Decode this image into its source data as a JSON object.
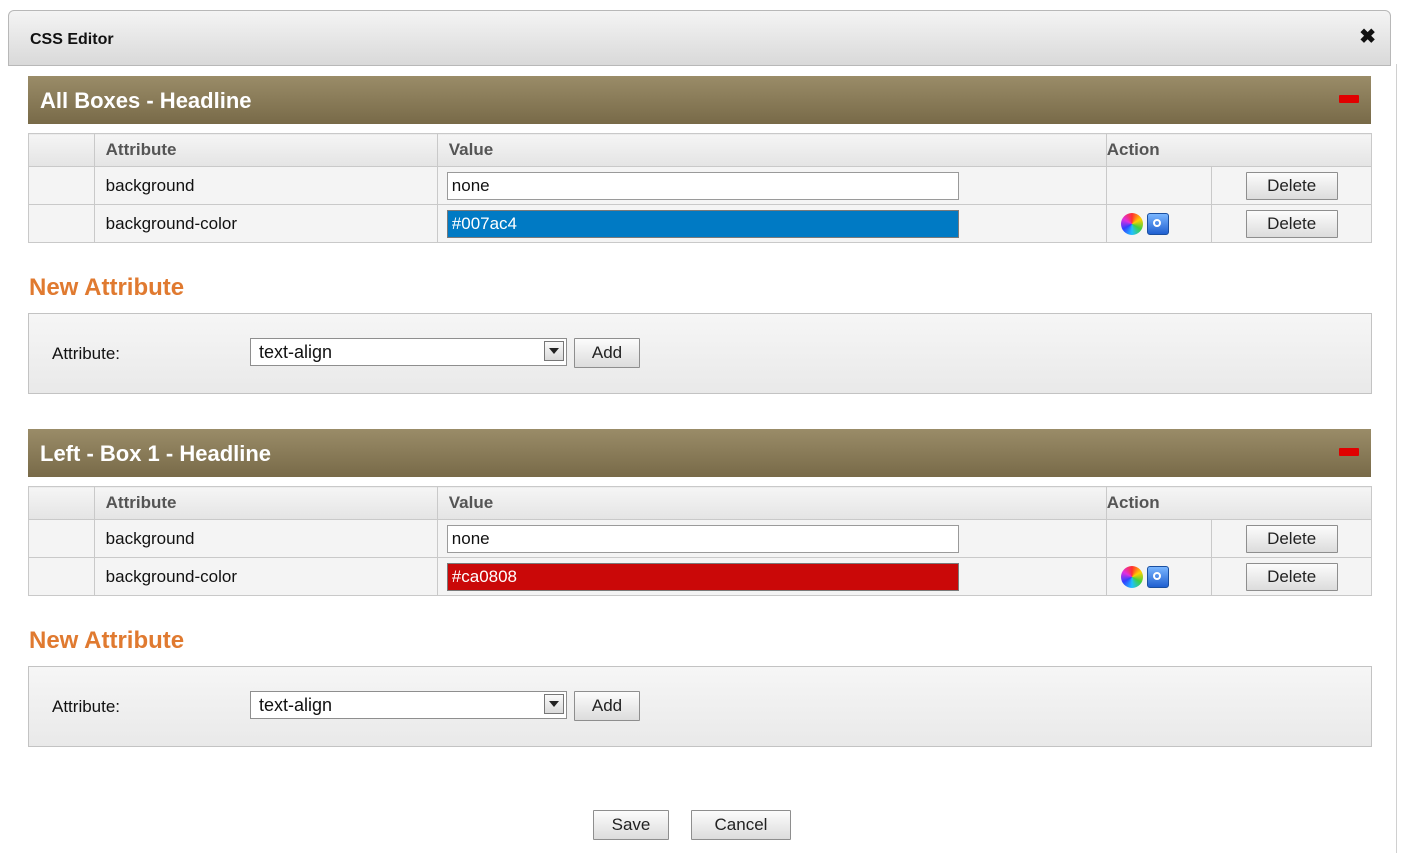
{
  "dialog": {
    "title": "CSS Editor",
    "close_icon": "close-icon"
  },
  "columns": {
    "attribute": "Attribute",
    "value": "Value",
    "action": "Action"
  },
  "sections": [
    {
      "title": "All Boxes - Headline",
      "rows": [
        {
          "attribute": "background",
          "value": "none",
          "delete_label": "Delete"
        },
        {
          "attribute": "background-color",
          "value": "#007ac4",
          "delete_label": "Delete",
          "swatch": "#007ac4"
        }
      ],
      "new_attribute": {
        "heading": "New Attribute",
        "label": "Attribute:",
        "selected": "text-align",
        "add_label": "Add"
      }
    },
    {
      "title": "Left - Box 1 - Headline",
      "rows": [
        {
          "attribute": "background",
          "value": "none",
          "delete_label": "Delete"
        },
        {
          "attribute": "background-color",
          "value": "#ca0808",
          "delete_label": "Delete",
          "swatch": "#ca0808"
        }
      ],
      "new_attribute": {
        "heading": "New Attribute",
        "label": "Attribute:",
        "selected": "text-align",
        "add_label": "Add"
      }
    }
  ],
  "footer": {
    "save_label": "Save",
    "cancel_label": "Cancel"
  },
  "colors": {
    "section_header": "#8a7c58",
    "new_attribute_heading": "#e07a30",
    "collapse_icon": "#e00000"
  }
}
